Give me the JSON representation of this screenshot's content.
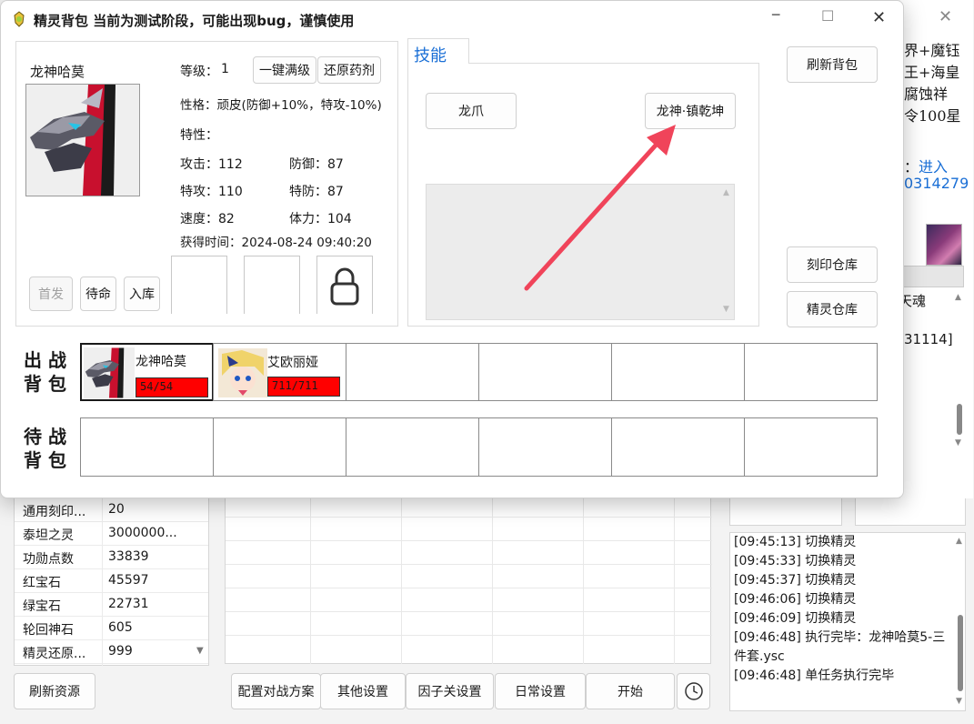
{
  "window": {
    "title": "精灵背包 当前为测试阶段，可能出现bug，谨慎使用",
    "min_glyph": "─",
    "max_glyph": "☐",
    "close_glyph": "✕"
  },
  "pet": {
    "name": "龙神哈莫",
    "level_label": "等级：",
    "level": "1",
    "max_level_btn": "一键满级",
    "restore_potion_btn": "还原药剂",
    "nature": "性格：顽皮(防御+10%，特攻-10%)",
    "trait": "特性：",
    "attack": "攻击：112",
    "defense": "防御：87",
    "sp_attack": "特攻：110",
    "sp_defense": "特防：87",
    "speed": "速度：82",
    "hp": "体力：104",
    "obtained": "获得时间：2024-08-24 09:40:20",
    "first_btn": "首发",
    "standby_btn": "待命",
    "store_btn": "入库"
  },
  "skills": {
    "tab_label": "技能",
    "skill1": "龙爪",
    "skill2": "龙神·镇乾坤"
  },
  "right_buttons": {
    "refresh_bag": "刷新背包",
    "imprint_storage": "刻印仓库",
    "pet_storage": "精灵仓库"
  },
  "battle_bag": {
    "label": "出 战\n背 包",
    "pets": [
      {
        "name": "龙神哈莫",
        "hp": "54/54"
      },
      {
        "name": "艾欧丽娅",
        "hp": "711/711"
      }
    ]
  },
  "standby_bag": {
    "label": "待 战\n背 包"
  },
  "background": {
    "right_text_lines": [
      "界+魔钰",
      "王+海皇",
      "腐蚀祥",
      "令100星"
    ],
    "link_prefix": "道：",
    "link_text": "进入",
    "link_number": "0314279",
    "soul_text": "天魂",
    "id_text": "31114]",
    "resources": [
      {
        "name": "通用刻印...",
        "value": "20"
      },
      {
        "name": "泰坦之灵",
        "value": "3000000..."
      },
      {
        "name": "功勋点数",
        "value": "33839"
      },
      {
        "name": "红宝石",
        "value": "45597"
      },
      {
        "name": "绿宝石",
        "value": "22731"
      },
      {
        "name": "轮回神石",
        "value": "605"
      },
      {
        "name": "精灵还原...",
        "value": "999"
      }
    ],
    "refresh_resources": "刷新资源",
    "bottom_buttons": [
      "配置对战方案",
      "其他设置",
      "因子关设置",
      "日常设置",
      "开始"
    ],
    "log": [
      "[09:45:13] 切换精灵",
      "[09:45:33] 切换精灵",
      "[09:45:37] 切换精灵",
      "[09:46:06] 切换精灵",
      "[09:46:09] 切换精灵",
      "[09:46:48] 执行完毕：龙神哈莫5-三",
      "件套.ysc",
      "[09:46:48] 单任务执行完毕"
    ]
  },
  "colors": {
    "accent_blue": "#1a6fd6",
    "hp_bar": "#ff0000",
    "arrow": "#f0445a"
  }
}
